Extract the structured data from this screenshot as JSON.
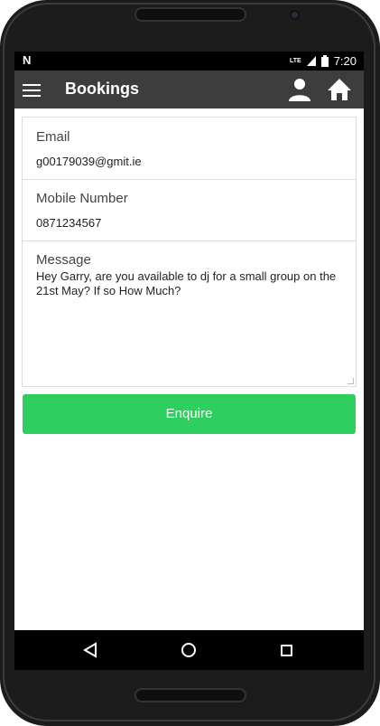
{
  "status_bar": {
    "notification_icon": "N",
    "network": "LTE",
    "time": "7:20"
  },
  "app_bar": {
    "title": "Bookings",
    "menu_icon": "hamburger-menu-icon",
    "profile_icon": "person-icon",
    "home_icon": "home-icon"
  },
  "form": {
    "email": {
      "label": "Email",
      "value": "g00179039@gmit.ie"
    },
    "mobile": {
      "label": "Mobile Number",
      "value": "0871234567"
    },
    "message": {
      "label": "Message",
      "value": "Hey Garry, are you available to dj for a small group on the 21st May? If so How Much?"
    }
  },
  "enquire_button": {
    "label": "Enquire",
    "color": "#2fcf5f"
  },
  "nav_bar": {
    "back_icon": "back-triangle-icon",
    "home_icon": "home-circle-icon",
    "recents_icon": "recents-square-icon"
  }
}
